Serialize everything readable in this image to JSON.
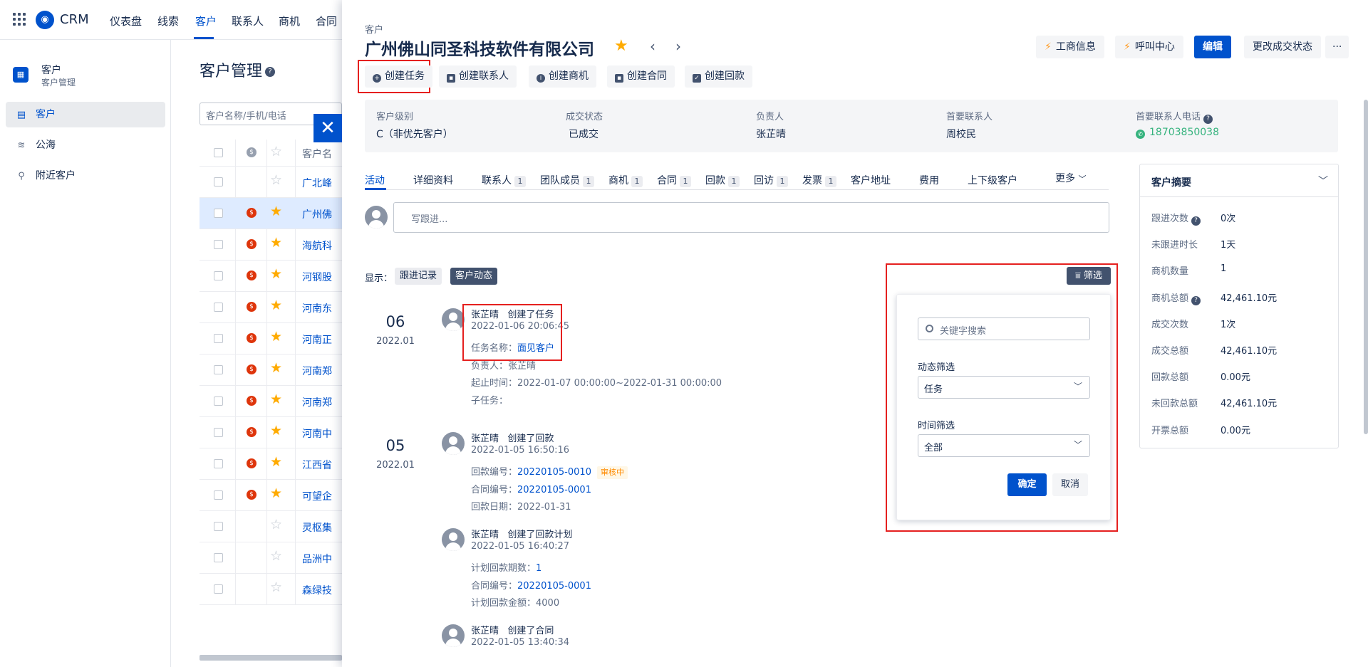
{
  "topnav": {
    "brand": "CRM",
    "items": [
      "仪表盘",
      "线索",
      "客户",
      "联系人",
      "商机",
      "合同"
    ],
    "active_index": 2
  },
  "sidebar": {
    "app_title": "客户",
    "app_subtitle": "客户管理",
    "items": [
      {
        "label": "客户",
        "icon": "building-icon"
      },
      {
        "label": "公海",
        "icon": "waves-icon"
      },
      {
        "label": "附近客户",
        "icon": "location-pin-icon"
      }
    ]
  },
  "list": {
    "title": "客户管理",
    "search_placeholder": "客户名称/手机/电话",
    "header": "客户名",
    "rows": [
      {
        "name": "广北峰",
        "star": false,
        "tag": false
      },
      {
        "name": "广州佛",
        "star": true,
        "tag": true,
        "selected": true
      },
      {
        "name": "海航科",
        "star": true,
        "tag": true
      },
      {
        "name": "河钢股",
        "star": true,
        "tag": true
      },
      {
        "name": "河南东",
        "star": true,
        "tag": true
      },
      {
        "name": "河南正",
        "star": true,
        "tag": true
      },
      {
        "name": "河南郑",
        "star": true,
        "tag": true
      },
      {
        "name": "河南郑",
        "star": true,
        "tag": true
      },
      {
        "name": "河南中",
        "star": true,
        "tag": true
      },
      {
        "name": "江西省",
        "star": true,
        "tag": true
      },
      {
        "name": "可望企",
        "star": true,
        "tag": true
      },
      {
        "name": "灵枢集",
        "star": false,
        "tag": false
      },
      {
        "name": "品洲中",
        "star": false,
        "tag": false
      },
      {
        "name": "森绿技",
        "star": false,
        "tag": false
      }
    ]
  },
  "drawer": {
    "breadcrumb": "客户",
    "title": "广州佛山同圣科技软件有限公司",
    "header_buttons": {
      "business_info": "工商信息",
      "call_center": "呼叫中心",
      "edit": "编辑",
      "change_status": "更改成交状态",
      "more": "···"
    },
    "action_buttons": [
      "创建任务",
      "创建联系人",
      "创建商机",
      "创建合同",
      "创建回款"
    ],
    "info": [
      {
        "label": "客户级别",
        "value": "C（非优先客户）"
      },
      {
        "label": "成交状态",
        "value": "已成交"
      },
      {
        "label": "负责人",
        "value": "张芷晴"
      },
      {
        "label": "首要联系人",
        "value": "周校民"
      },
      {
        "label": "首要联系人电话",
        "value": "18703850038"
      }
    ],
    "tabs": [
      {
        "label": "活动"
      },
      {
        "label": "详细资料"
      },
      {
        "label": "联系人",
        "badge": "1"
      },
      {
        "label": "团队成员",
        "badge": "1"
      },
      {
        "label": "商机",
        "badge": "1"
      },
      {
        "label": "合同",
        "badge": "1"
      },
      {
        "label": "回款",
        "badge": "1"
      },
      {
        "label": "回访",
        "badge": "1"
      },
      {
        "label": "发票",
        "badge": "1"
      },
      {
        "label": "客户地址"
      },
      {
        "label": "费用"
      },
      {
        "label": "上下级客户"
      },
      {
        "label": "更多"
      }
    ],
    "writer_placeholder": "写跟进...",
    "display_label": "显示：",
    "display_options": [
      "跟进记录",
      "客户动态"
    ],
    "timeline": [
      {
        "day": "06",
        "ym": "2022.01",
        "entries": [
          {
            "name": "张芷晴",
            "action": "创建了任务",
            "time": "2022-01-06 20:06:45",
            "lines": [
              [
                "任务名称：",
                "面见客户"
              ],
              [
                "负责人：张芷晴",
                ""
              ],
              [
                "起止时间：2022-01-07 00:00:00~2022-01-31 00:00:00",
                ""
              ],
              [
                "子任务：",
                ""
              ]
            ]
          }
        ]
      },
      {
        "day": "05",
        "ym": "2022.01",
        "entries": [
          {
            "name": "张芷晴",
            "action": "创建了回款",
            "time": "2022-01-05 16:50:16",
            "lines": [
              [
                "回款编号：",
                "20220105-0010"
              ],
              [
                "合同编号：",
                "20220105-0001"
              ],
              [
                "回款日期：2022-01-31",
                ""
              ]
            ],
            "pending": "审核中"
          },
          {
            "name": "张芷晴",
            "action": "创建了回款计划",
            "time": "2022-01-05 16:40:27",
            "lines": [
              [
                "计划回款期数：",
                "1"
              ],
              [
                "合同编号：",
                "20220105-0001"
              ],
              [
                "计划回款金额：4000",
                ""
              ]
            ]
          },
          {
            "name": "张芷晴",
            "action": "创建了合同",
            "time": "2022-01-05 13:40:34",
            "lines": []
          }
        ]
      }
    ],
    "filter": {
      "button": "筛选",
      "keyword_placeholder": "关键字搜索",
      "dynamic_label": "动态筛选",
      "dynamic_value": "任务",
      "time_label": "时间筛选",
      "time_value": "全部",
      "ok": "确定",
      "cancel": "取消"
    },
    "summary": {
      "title": "客户摘要",
      "rows": [
        {
          "label": "跟进次数",
          "value": "0次",
          "help": true
        },
        {
          "label": "未跟进时长",
          "value": "1天"
        },
        {
          "label": "商机数量",
          "value": "1"
        },
        {
          "label": "商机总额",
          "value": "42,461.10元",
          "help": true
        },
        {
          "label": "成交次数",
          "value": "1次"
        },
        {
          "label": "成交总额",
          "value": "42,461.10元"
        },
        {
          "label": "回款总额",
          "value": "0.00元"
        },
        {
          "label": "未回款总额",
          "value": "42,461.10元"
        },
        {
          "label": "开票总额",
          "value": "0.00元"
        }
      ]
    }
  }
}
